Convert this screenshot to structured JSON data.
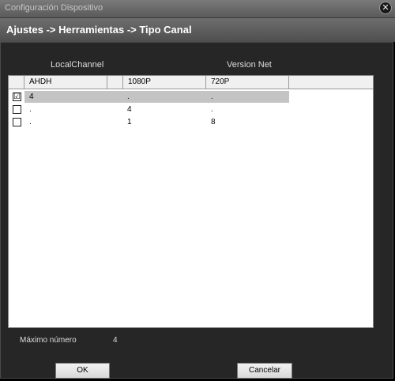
{
  "window": {
    "title": "Configuración Dispositivo",
    "close_icon": "✕"
  },
  "breadcrumb": "Ajustes -> Herramientas -> Tipo Canal",
  "captions": {
    "local_channel": "LocalChannel",
    "version_net": "Version Net"
  },
  "table": {
    "headers": [
      "AHDH",
      "",
      "1080P",
      "720P"
    ],
    "rows": [
      {
        "checked": true,
        "mark": "☑",
        "c1": "4",
        "c2": ".",
        "c3": "."
      },
      {
        "checked": false,
        "mark": "",
        "c1": ".",
        "c2": "4",
        "c3": "."
      },
      {
        "checked": false,
        "mark": "",
        "c1": ".",
        "c2": "1",
        "c3": "8"
      }
    ]
  },
  "footer": {
    "max_label": "Máximo número",
    "max_value": "4"
  },
  "buttons": {
    "ok": "OK",
    "cancel": "Cancelar"
  }
}
